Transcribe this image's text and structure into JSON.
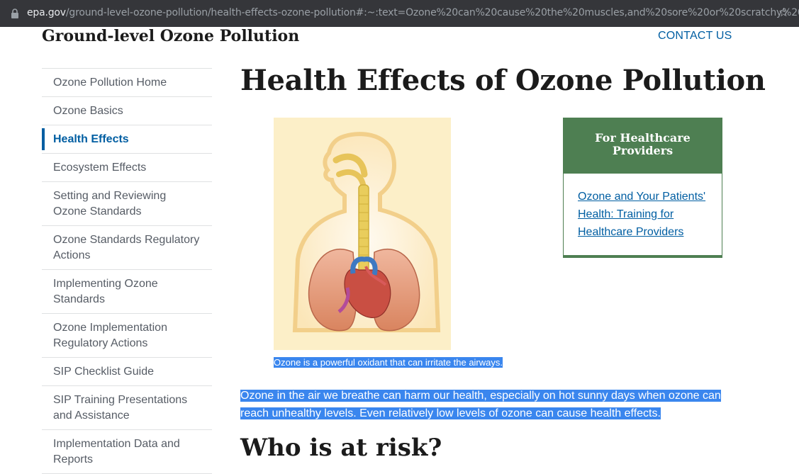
{
  "browser": {
    "url_host": "epa.gov",
    "url_path": "/ground-level-ozone-pollution/health-effects-ozone-pollution#:~:text=Ozone%20can%20cause%20the%20muscles,and%20sore%20or%20scratchy%20throat."
  },
  "header": {
    "site_title": "Ground-level Ozone Pollution",
    "contact_label": "CONTACT US"
  },
  "sidebar": {
    "items": [
      {
        "label": "Ozone Pollution Home"
      },
      {
        "label": "Ozone Basics"
      },
      {
        "label": "Health Effects",
        "active": true
      },
      {
        "label": "Ecosystem Effects"
      },
      {
        "label": "Setting and Reviewing Ozone Standards"
      },
      {
        "label": "Ozone Standards Regulatory Actions"
      },
      {
        "label": "Implementing Ozone Standards"
      },
      {
        "label": "Ozone Implementation Regulatory Actions"
      },
      {
        "label": "SIP Checklist Guide"
      },
      {
        "label": "SIP Training Presentations and Assistance"
      },
      {
        "label": "Implementation Data and Reports"
      }
    ]
  },
  "main": {
    "title": "Health Effects of Ozone Pollution",
    "figure_caption": "Ozone is a powerful oxidant that can irritate the airways.",
    "intro_paragraph": "Ozone in the air we breathe can harm our health, especially on hot sunny days when ozone can reach unhealthy levels. Even relatively low levels of ozone can cause health effects.",
    "next_heading": "Who is at risk?"
  },
  "healthcare_box": {
    "heading": "For Healthcare Providers",
    "link_label": "Ozone and Your Patients' Health: Training for Healthcare Providers"
  },
  "colors": {
    "link": "#005ea2",
    "healthcare_green": "#4e7f52",
    "selection": "#3a86ee",
    "figure_background": "#fcefc8"
  }
}
